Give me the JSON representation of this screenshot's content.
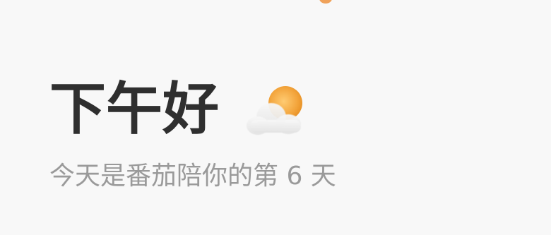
{
  "header": {
    "greeting": "下午好",
    "weather_icon": "partly-cloudy-sun-icon",
    "subtitle": "今天是番茄陪你的第 6 天"
  },
  "colors": {
    "background": "#f8f8f8",
    "greeting_text": "#2f2f2f",
    "subtitle_text": "#9a9a9a",
    "sun": "#f2a33a",
    "cloud": "#ededed"
  }
}
